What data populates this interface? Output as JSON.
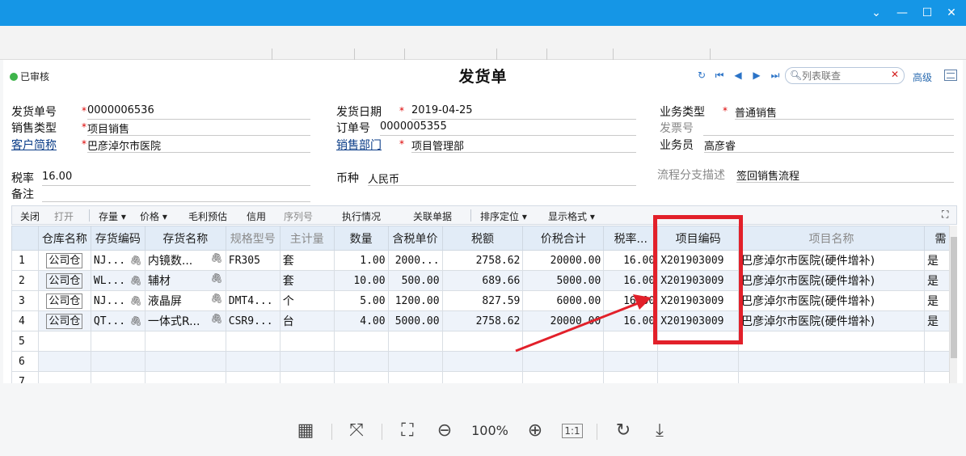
{
  "window": {
    "controls": [
      "⌄",
      "—",
      "☐",
      "✕"
    ]
  },
  "header": {
    "status": "已审核",
    "title": "发货单",
    "search_placeholder": "列表联查",
    "advanced_label": "高级"
  },
  "form": {
    "doc_no_label": "发货单号",
    "doc_no": "0000006536",
    "ship_date_label": "发货日期",
    "ship_date": "2019-04-25",
    "biz_type_label": "业务类型",
    "biz_type": "普通销售",
    "sale_type_label": "销售类型",
    "sale_type": "项目销售",
    "order_no_label": "订单号",
    "order_no": "0000005355",
    "invoice_no_label": "发票号",
    "invoice_no": "",
    "customer_label": "客户简称",
    "customer": "巴彦淖尔市医院",
    "dept_label": "销售部门",
    "dept": "项目管理部",
    "salesman_label": "业务员",
    "salesman": "高彦睿",
    "tax_rate_label": "税率",
    "tax_rate": "16.00",
    "currency_label": "币种",
    "currency": "人民币",
    "flow_label": "流程分支描述",
    "flow": "签回销售流程",
    "remark_label": "备注",
    "remark": ""
  },
  "toolbar": {
    "close": "关闭",
    "open": "打开",
    "stock": "存量",
    "price": "价格",
    "margin": "毛利预估",
    "credit": "信用",
    "serial": "序列号",
    "exec": "执行情况",
    "related": "关联单据",
    "sort": "排序定位",
    "format": "显示格式"
  },
  "grid": {
    "columns": [
      "",
      "仓库名称",
      "存货编码",
      "存货名称",
      "规格型号",
      "主计量",
      "数量",
      "含税单价",
      "税额",
      "价税合计",
      "税率...",
      "项目编码",
      "项目名称",
      "需"
    ],
    "rows": [
      {
        "no": "1",
        "wh": "公司仓",
        "code": "NJ...",
        "name": "内镜数...",
        "spec": "FR305",
        "unit": "套",
        "qty": "1.00",
        "price": "2000...",
        "tax": "2758.62",
        "total": "20000.00",
        "rate": "16.00",
        "proj_code": "X201903009",
        "proj_name": "巴彦淖尔市医院(硬件增补)",
        "need": "是"
      },
      {
        "no": "2",
        "wh": "公司仓",
        "code": "WL...",
        "name": "辅材",
        "spec": "",
        "unit": "套",
        "qty": "10.00",
        "price": "500.00",
        "tax": "689.66",
        "total": "5000.00",
        "rate": "16.00",
        "proj_code": "X201903009",
        "proj_name": "巴彦淖尔市医院(硬件增补)",
        "need": "是"
      },
      {
        "no": "3",
        "wh": "公司仓",
        "code": "NJ...",
        "name": "液晶屏",
        "spec": "DMT4...",
        "unit": "个",
        "qty": "5.00",
        "price": "1200.00",
        "tax": "827.59",
        "total": "6000.00",
        "rate": "16.00",
        "proj_code": "X201903009",
        "proj_name": "巴彦淖尔市医院(硬件增补)",
        "need": "是"
      },
      {
        "no": "4",
        "wh": "公司仓",
        "code": "QT...",
        "name": "一体式R...",
        "spec": "CSR9...",
        "unit": "台",
        "qty": "4.00",
        "price": "5000.00",
        "tax": "2758.62",
        "total": "20000.00",
        "rate": "16.00",
        "proj_code": "X201903009",
        "proj_name": "巴彦淖尔市医院(硬件增补)",
        "need": "是"
      }
    ],
    "empty_row_numbers": [
      "5",
      "6",
      "7"
    ]
  },
  "viewer": {
    "zoom": "100%"
  }
}
